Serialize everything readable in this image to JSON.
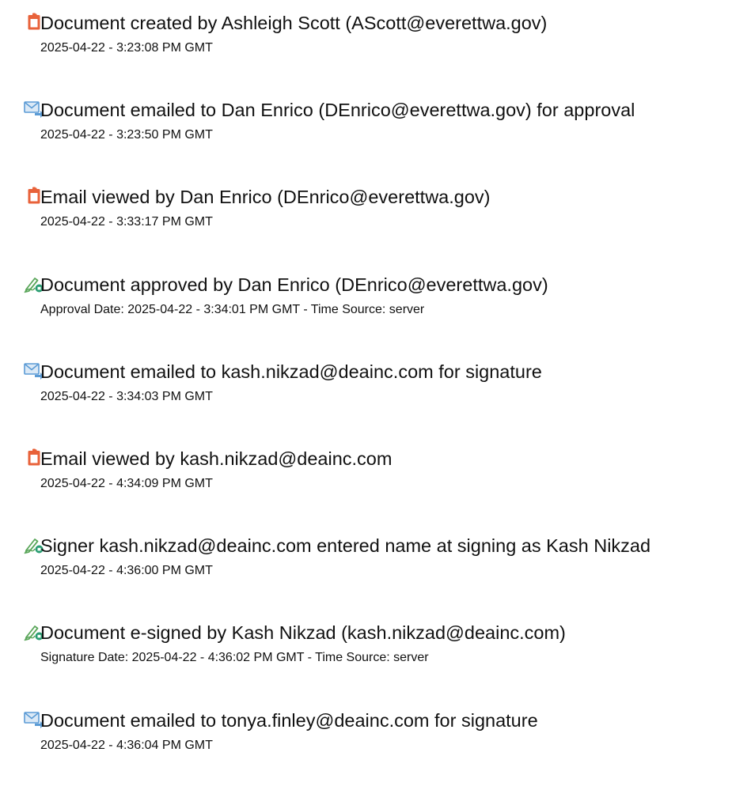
{
  "icons": {
    "document": "document-icon",
    "email": "email-icon",
    "sign": "pen-sign-icon"
  },
  "colors": {
    "document_icon": "#e8623a",
    "email_icon": "#5b9bd5",
    "sign_icon": "#2a9d72"
  },
  "events": [
    {
      "icon": "document-icon",
      "title": "Document created by Ashleigh Scott (AScott@everettwa.gov)",
      "detail": "2025-04-22 - 3:23:08 PM GMT"
    },
    {
      "icon": "email-icon",
      "title": "Document emailed to Dan Enrico (DEnrico@everettwa.gov) for approval",
      "detail": "2025-04-22 - 3:23:50 PM GMT"
    },
    {
      "icon": "document-icon",
      "title": "Email viewed by Dan Enrico (DEnrico@everettwa.gov)",
      "detail": "2025-04-22 - 3:33:17 PM GMT"
    },
    {
      "icon": "pen-sign-icon",
      "title": "Document approved by Dan Enrico (DEnrico@everettwa.gov)",
      "detail": "Approval Date: 2025-04-22 - 3:34:01 PM GMT - Time Source: server"
    },
    {
      "icon": "email-icon",
      "title": "Document emailed to kash.nikzad@deainc.com for signature",
      "detail": "2025-04-22 - 3:34:03 PM GMT"
    },
    {
      "icon": "document-icon",
      "title": "Email viewed by kash.nikzad@deainc.com",
      "detail": "2025-04-22 - 4:34:09 PM GMT"
    },
    {
      "icon": "pen-sign-icon",
      "title": "Signer kash.nikzad@deainc.com entered name at signing as Kash Nikzad",
      "detail": "2025-04-22 - 4:36:00 PM GMT"
    },
    {
      "icon": "pen-sign-icon",
      "title": "Document e-signed by Kash Nikzad (kash.nikzad@deainc.com)",
      "detail": "Signature Date: 2025-04-22 - 4:36:02 PM GMT - Time Source: server"
    },
    {
      "icon": "email-icon",
      "title": "Document emailed to tonya.finley@deainc.com for signature",
      "detail": "2025-04-22 - 4:36:04 PM GMT"
    }
  ]
}
